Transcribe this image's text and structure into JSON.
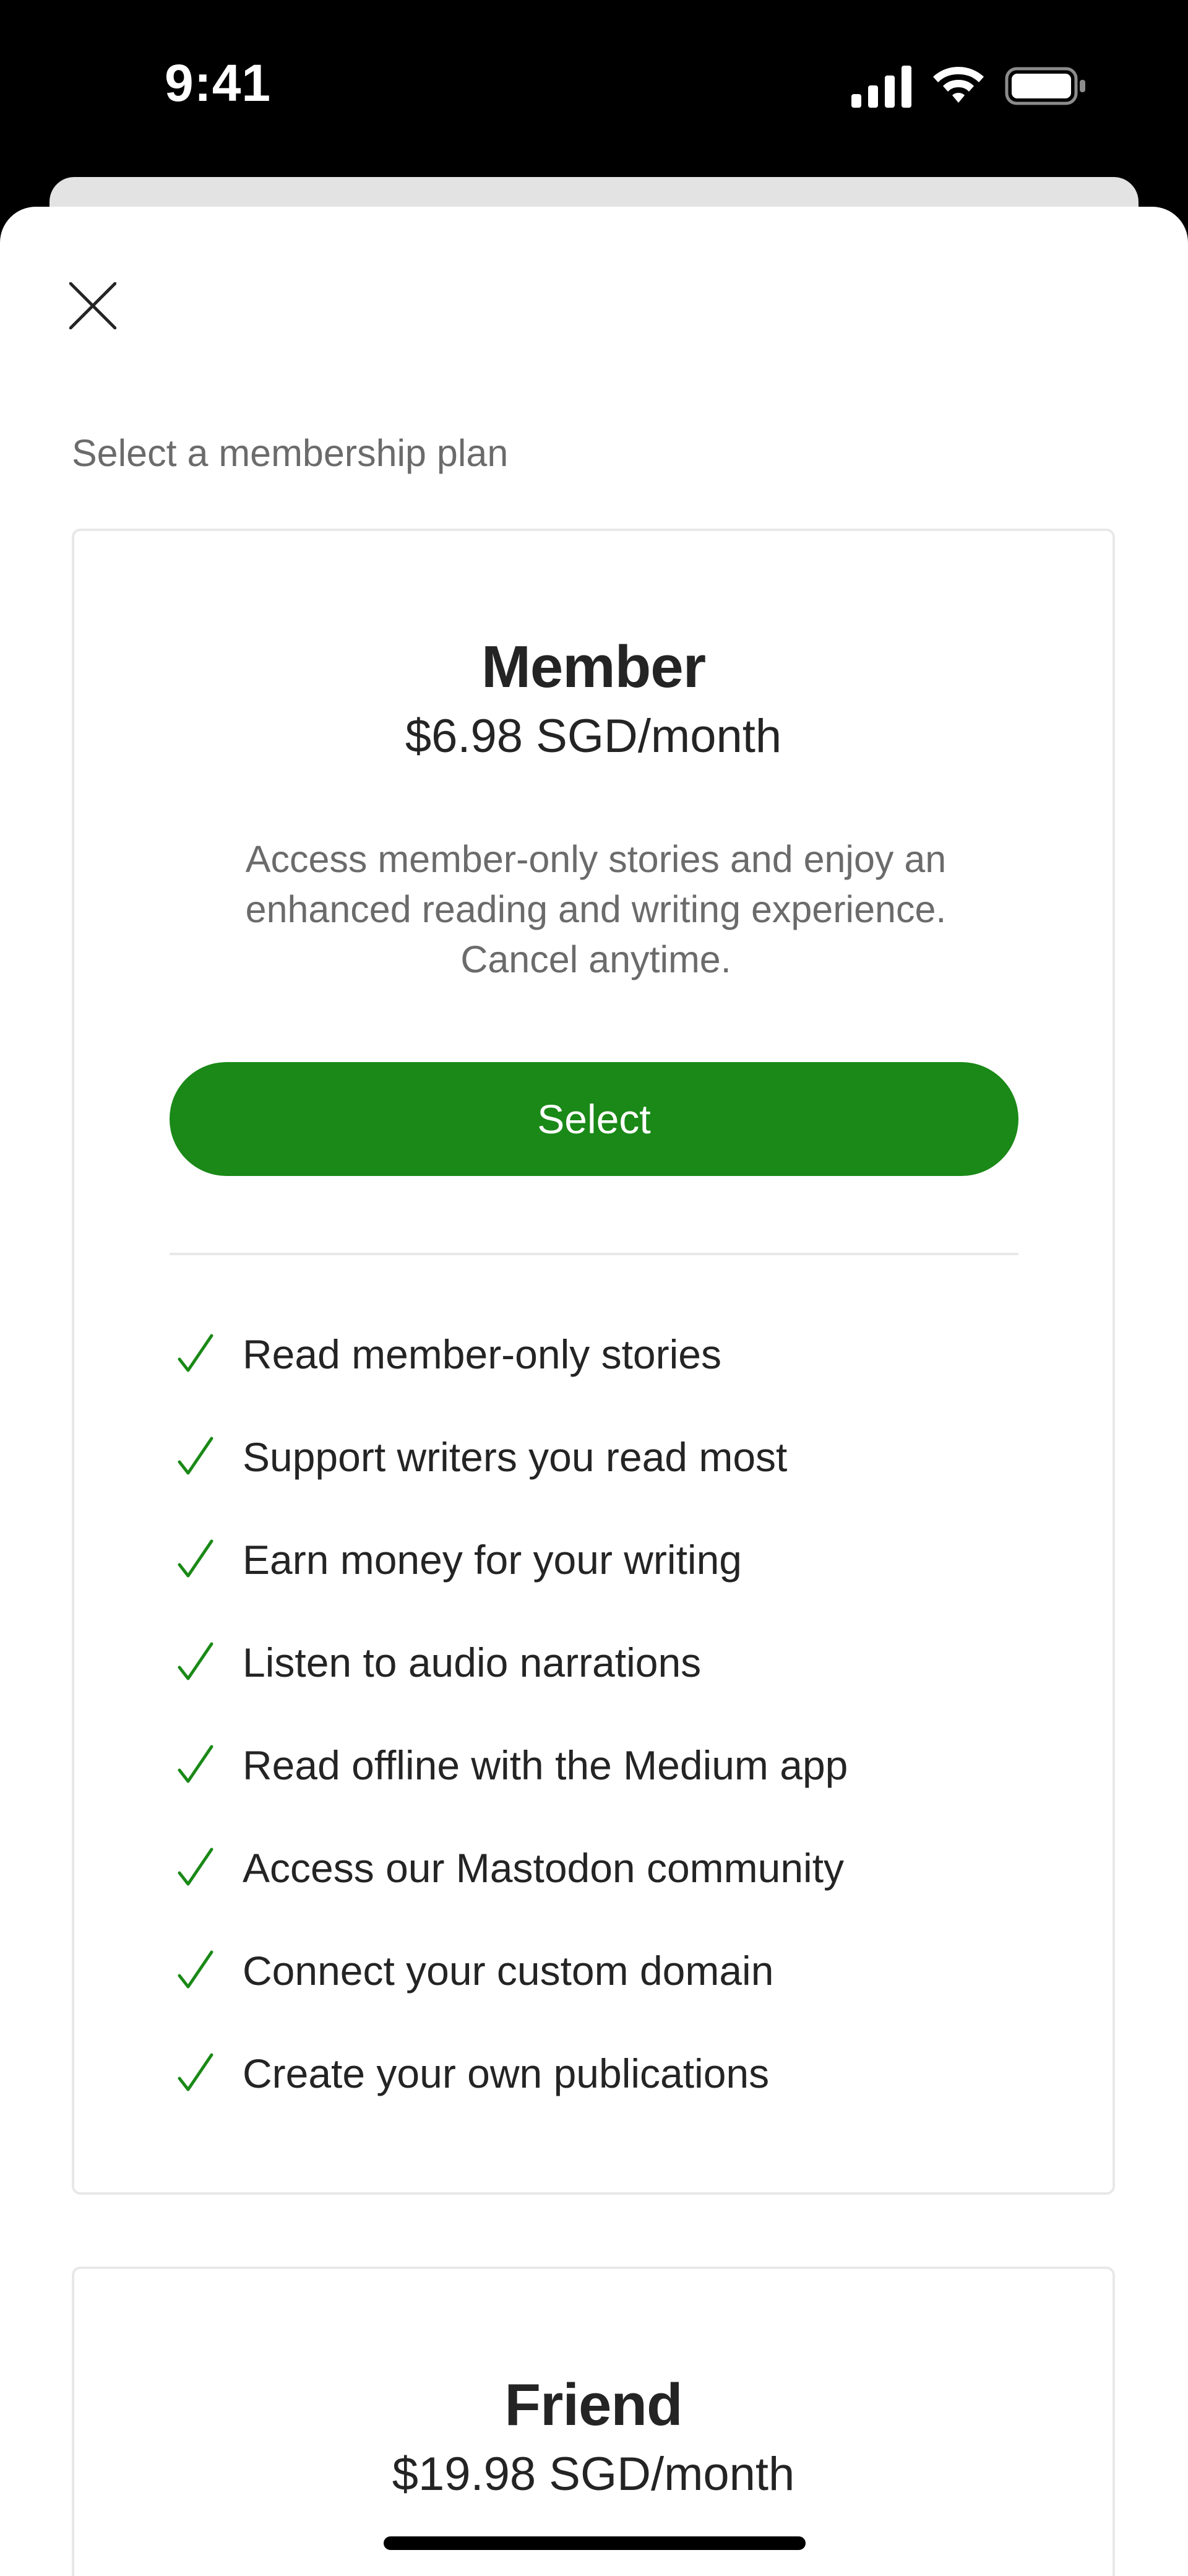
{
  "status_bar": {
    "time": "9:41"
  },
  "sheet": {
    "title": "Select a membership plan",
    "close_icon": "close-icon"
  },
  "plans": [
    {
      "name": "Member",
      "price": "$6.98 SGD/month",
      "description": "Access member-only stories and enjoy an enhanced reading and writing experience. Cancel anytime.",
      "button_label": "Select",
      "benefits": [
        "Read member-only stories",
        "Support writers you read most",
        "Earn money for your writing",
        "Listen to audio narrations",
        "Read offline with the Medium app",
        "Access our Mastodon community",
        "Connect your custom domain",
        "Create your own publications"
      ]
    },
    {
      "name": "Friend",
      "price": "$19.98 SGD/month"
    }
  ],
  "colors": {
    "accent_green": "#1a8917",
    "text_primary": "#242424",
    "text_secondary": "#6b6b6b",
    "border": "#e8e8e8"
  }
}
